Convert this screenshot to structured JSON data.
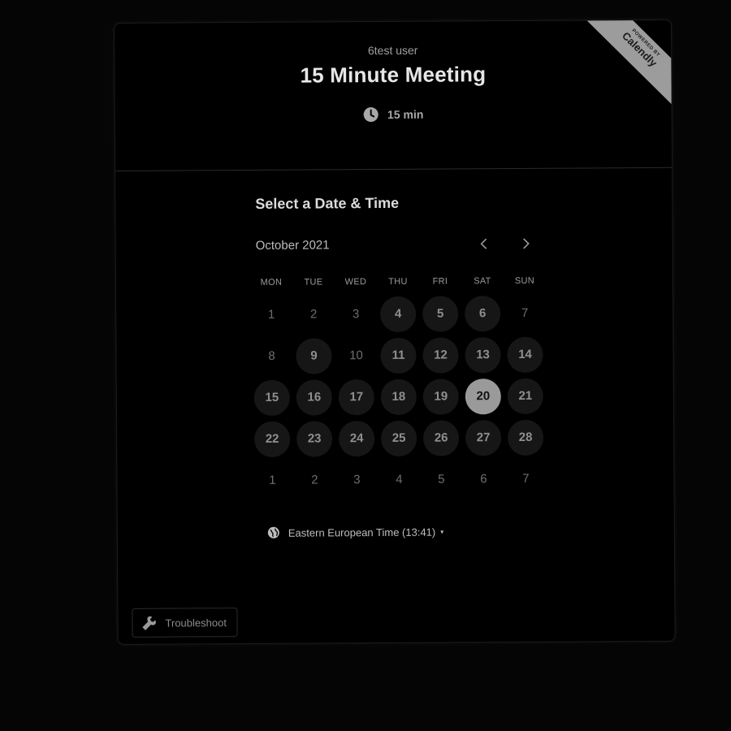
{
  "header": {
    "host_name": "6test user",
    "event_title": "15 Minute Meeting",
    "duration": "15 min",
    "duration_icon": "clock-icon"
  },
  "badge": {
    "small_text": "POWERED BY",
    "brand": "Calendly",
    "color": "#9c9c9c"
  },
  "scheduler": {
    "section_title": "Select a Date & Time",
    "month_label": "October 2021",
    "prev_icon": "chevron-left-icon",
    "next_icon": "chevron-right-icon",
    "weekdays": [
      "MON",
      "TUE",
      "WED",
      "THU",
      "FRI",
      "SAT",
      "SUN"
    ],
    "days": [
      {
        "label": "1",
        "state": "unavailable"
      },
      {
        "label": "2",
        "state": "unavailable"
      },
      {
        "label": "3",
        "state": "unavailable"
      },
      {
        "label": "4",
        "state": "available"
      },
      {
        "label": "5",
        "state": "available"
      },
      {
        "label": "6",
        "state": "available"
      },
      {
        "label": "7",
        "state": "unavailable"
      },
      {
        "label": "8",
        "state": "unavailable"
      },
      {
        "label": "9",
        "state": "available"
      },
      {
        "label": "10",
        "state": "unavailable"
      },
      {
        "label": "11",
        "state": "available"
      },
      {
        "label": "12",
        "state": "available"
      },
      {
        "label": "13",
        "state": "available"
      },
      {
        "label": "14",
        "state": "available"
      },
      {
        "label": "15",
        "state": "available"
      },
      {
        "label": "16",
        "state": "available"
      },
      {
        "label": "17",
        "state": "available"
      },
      {
        "label": "18",
        "state": "available"
      },
      {
        "label": "19",
        "state": "available"
      },
      {
        "label": "20",
        "state": "selected"
      },
      {
        "label": "21",
        "state": "available"
      },
      {
        "label": "22",
        "state": "available"
      },
      {
        "label": "23",
        "state": "available"
      },
      {
        "label": "24",
        "state": "available"
      },
      {
        "label": "25",
        "state": "available"
      },
      {
        "label": "26",
        "state": "available"
      },
      {
        "label": "27",
        "state": "available"
      },
      {
        "label": "28",
        "state": "available"
      },
      {
        "label": "1",
        "state": "unavailable"
      },
      {
        "label": "2",
        "state": "unavailable"
      },
      {
        "label": "3",
        "state": "unavailable"
      },
      {
        "label": "4",
        "state": "unavailable"
      },
      {
        "label": "5",
        "state": "unavailable"
      },
      {
        "label": "6",
        "state": "unavailable"
      },
      {
        "label": "7",
        "state": "unavailable"
      }
    ],
    "timezone": {
      "label": "Eastern European Time (13:41)",
      "icon": "globe-icon",
      "caret": "▾"
    }
  },
  "footer": {
    "troubleshoot_label": "Troubleshoot",
    "troubleshoot_icon": "wrench-icon"
  },
  "colors": {
    "page_background": "#050505",
    "card_background": "#000000",
    "available_day": "#161616",
    "selected_day": "#9a9a9a"
  }
}
